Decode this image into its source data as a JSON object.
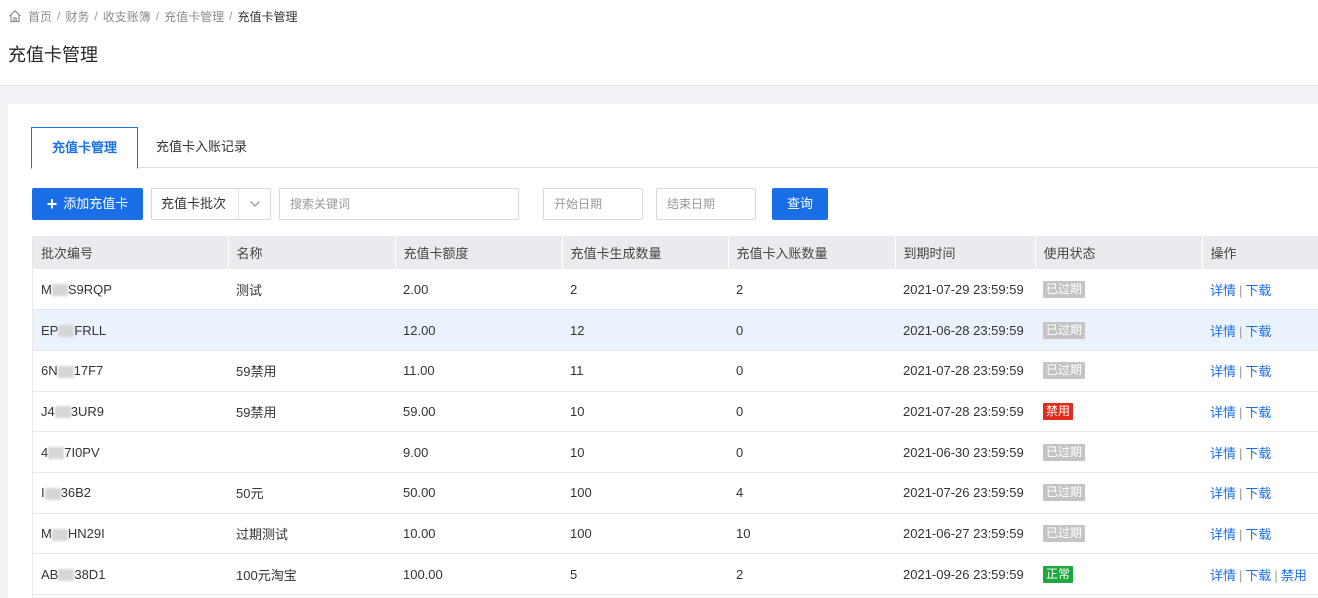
{
  "breadcrumb": {
    "items": [
      "首页",
      "财务",
      "收支账簿",
      "充值卡管理"
    ],
    "current": "充值卡管理"
  },
  "page_title": "充值卡管理",
  "tabs": [
    {
      "label": "充值卡管理",
      "active": true
    },
    {
      "label": "充值卡入账记录",
      "active": false
    }
  ],
  "toolbar": {
    "add_label": "添加充值卡",
    "select_value": "充值卡批次",
    "search_placeholder": "搜索关键词",
    "start_placeholder": "开始日期",
    "end_placeholder": "结束日期",
    "query_label": "查询"
  },
  "table": {
    "headers": [
      "批次编号",
      "名称",
      "充值卡额度",
      "充值卡生成数量",
      "充值卡入账数量",
      "到期时间",
      "使用状态",
      "操作"
    ],
    "rows": [
      {
        "code_pre": "M",
        "code_post": "S9RQP",
        "name": "测试",
        "amount": "2.00",
        "generated": "2",
        "credited": "2",
        "expire": "2021-07-29 23:59:59",
        "status": "已过期",
        "status_type": "expired",
        "ops": [
          "详情",
          "下载"
        ]
      },
      {
        "code_pre": "EP",
        "code_post": "FRLL",
        "name": "",
        "amount": "12.00",
        "generated": "12",
        "credited": "0",
        "expire": "2021-06-28 23:59:59",
        "status": "已过期",
        "status_type": "expired",
        "ops": [
          "详情",
          "下载"
        ]
      },
      {
        "code_pre": "6N",
        "code_post": "17F7",
        "name": "59禁用",
        "amount": "11.00",
        "generated": "11",
        "credited": "0",
        "expire": "2021-07-28 23:59:59",
        "status": "已过期",
        "status_type": "expired",
        "ops": [
          "详情",
          "下载"
        ]
      },
      {
        "code_pre": "J4",
        "code_post": "3UR9",
        "name": "59禁用",
        "amount": "59.00",
        "generated": "10",
        "credited": "0",
        "expire": "2021-07-28 23:59:59",
        "status": "禁用",
        "status_type": "disabled",
        "ops": [
          "详情",
          "下载"
        ]
      },
      {
        "code_pre": "4",
        "code_post": "7I0PV",
        "name": "",
        "amount": "9.00",
        "generated": "10",
        "credited": "0",
        "expire": "2021-06-30 23:59:59",
        "status": "已过期",
        "status_type": "expired",
        "ops": [
          "详情",
          "下载"
        ]
      },
      {
        "code_pre": "I",
        "code_post": "36B2",
        "name": "50元",
        "amount": "50.00",
        "generated": "100",
        "credited": "4",
        "expire": "2021-07-26 23:59:59",
        "status": "已过期",
        "status_type": "expired",
        "ops": [
          "详情",
          "下载"
        ]
      },
      {
        "code_pre": "M",
        "code_post": "HN29I",
        "name": "过期测试",
        "amount": "10.00",
        "generated": "100",
        "credited": "10",
        "expire": "2021-06-27 23:59:59",
        "status": "已过期",
        "status_type": "expired",
        "ops": [
          "详情",
          "下载"
        ]
      },
      {
        "code_pre": "AB",
        "code_post": "38D1",
        "name": "100元淘宝",
        "amount": "100.00",
        "generated": "5",
        "credited": "2",
        "expire": "2021-09-26 23:59:59",
        "status": "正常",
        "status_type": "normal",
        "ops": [
          "详情",
          "下载",
          "禁用"
        ]
      }
    ]
  },
  "colors": {
    "accent": "#1a6fe8",
    "expired": "#c4c4c4",
    "disabled": "#e02d1b",
    "normal": "#1ca83c"
  }
}
